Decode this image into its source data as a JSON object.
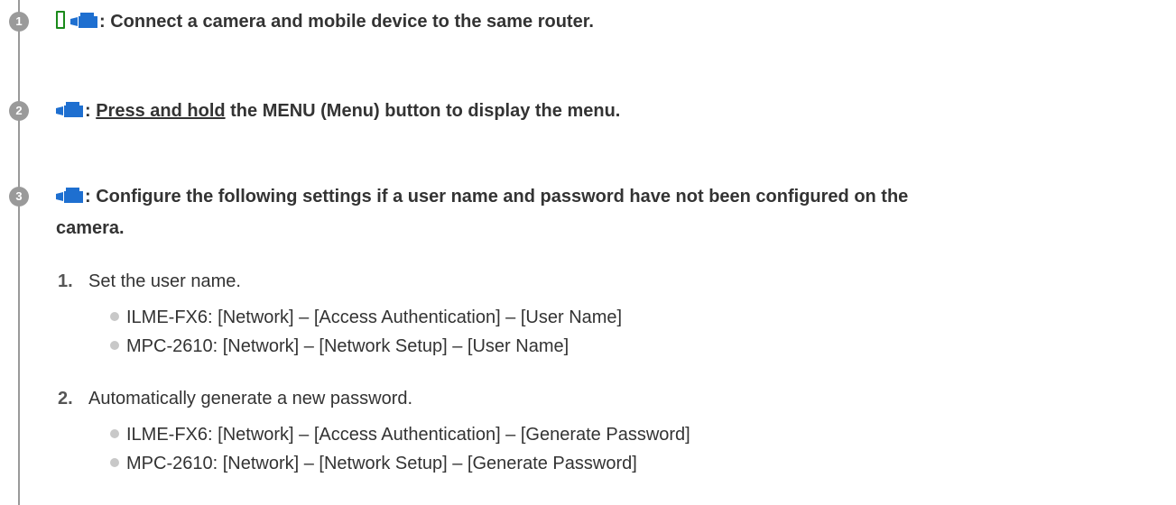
{
  "steps": [
    {
      "number": "1",
      "text": ": Connect a camera and mobile device to the same router."
    },
    {
      "number": "2",
      "prefix": ": ",
      "link": "Press and hold",
      "text": " the MENU (Menu) button to display the menu."
    },
    {
      "number": "3",
      "text_line1": ": Configure the following settings if a user name and password have not been configured on the",
      "text_line2": "camera.",
      "substeps": [
        {
          "number": "1.",
          "text": "Set the user name.",
          "bullets": [
            "ILME-FX6: [Network] – [Access Authentication] – [User Name]",
            "MPC-2610: [Network] – [Network Setup] – [User Name]"
          ]
        },
        {
          "number": "2.",
          "text": "Automatically generate a new password.",
          "bullets": [
            "ILME-FX6: [Network] – [Access Authentication] – [Generate Password]",
            "MPC-2610: [Network] – [Network Setup] – [Generate Password]"
          ]
        }
      ]
    }
  ],
  "icons": {
    "phone": "mobile-device-icon",
    "camera": "camera-icon",
    "phone_color": "#1a8a1a",
    "camera_color": "#1e6fd0"
  }
}
